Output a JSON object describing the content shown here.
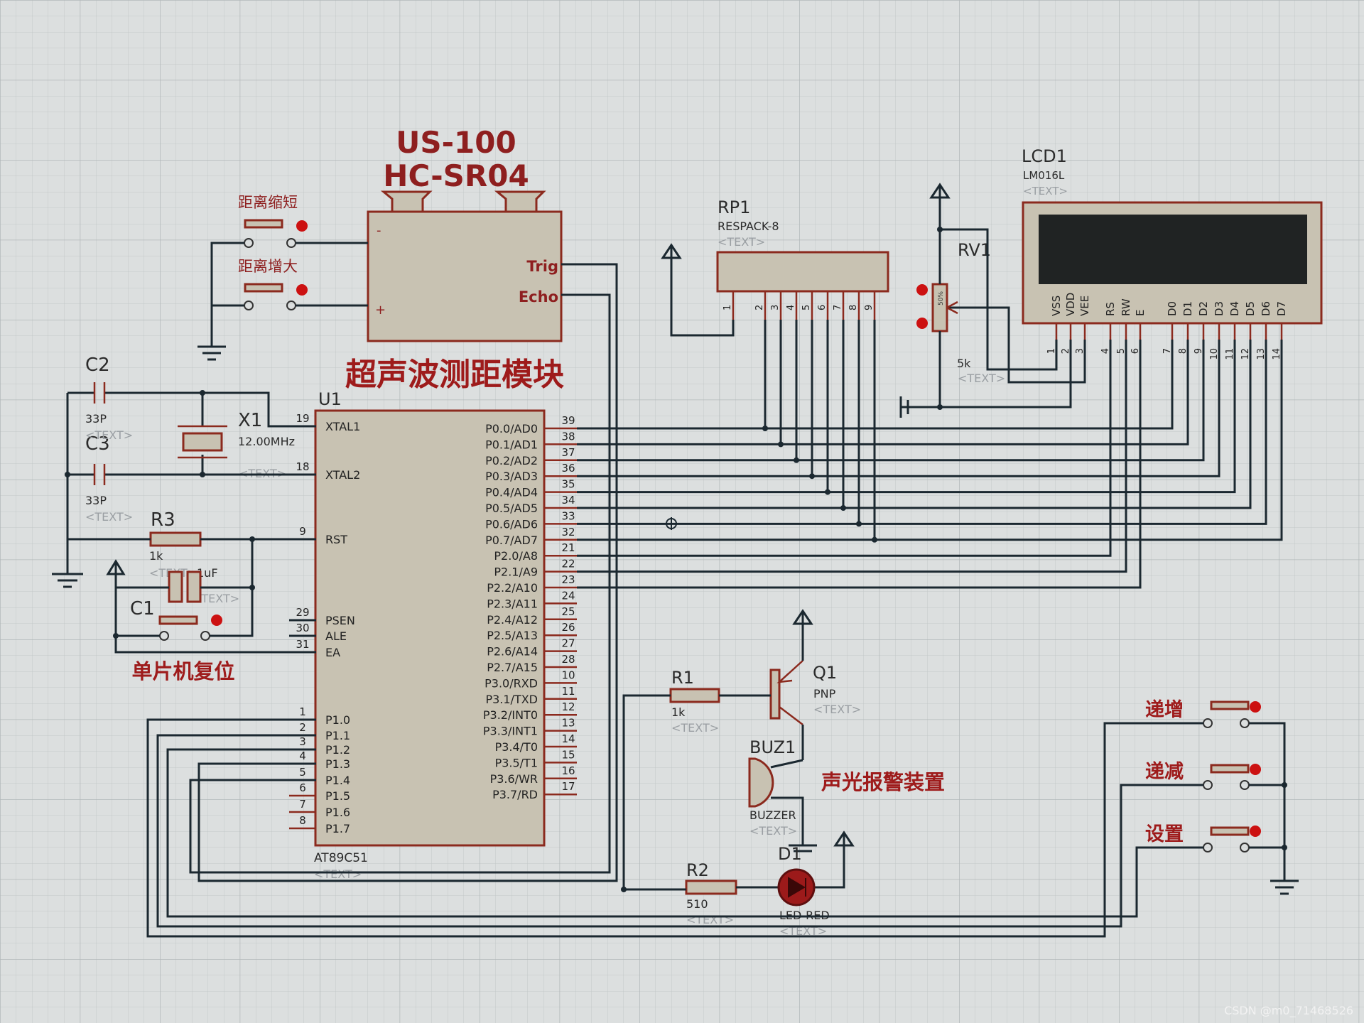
{
  "sensor": {
    "title1": "US-100",
    "title2": "HC-SR04",
    "pin_trig": "Trig",
    "pin_echo": "Echo",
    "pin_minus": "-",
    "pin_plus": "+",
    "caption": "超声波测距模块"
  },
  "buttons": {
    "dist_short": "距离缩短",
    "dist_long": "距离增大",
    "inc": "递增",
    "dec": "递减",
    "set": "设置"
  },
  "mcu": {
    "ref": "U1",
    "part": "AT89C51",
    "text": "<TEXT>",
    "left_pins": [
      {
        "num": "19",
        "name": "XTAL1"
      },
      {
        "num": "18",
        "name": "XTAL2"
      },
      {
        "num": "9",
        "name": "RST"
      },
      {
        "num": "29",
        "name": "PSEN"
      },
      {
        "num": "30",
        "name": "ALE"
      },
      {
        "num": "31",
        "name": "EA"
      },
      {
        "num": "1",
        "name": "P1.0"
      },
      {
        "num": "2",
        "name": "P1.1"
      },
      {
        "num": "3",
        "name": "P1.2"
      },
      {
        "num": "4",
        "name": "P1.3"
      },
      {
        "num": "5",
        "name": "P1.4"
      },
      {
        "num": "6",
        "name": "P1.5"
      },
      {
        "num": "7",
        "name": "P1.6"
      },
      {
        "num": "8",
        "name": "P1.7"
      }
    ],
    "right_pins": [
      {
        "num": "39",
        "name": "P0.0/AD0"
      },
      {
        "num": "38",
        "name": "P0.1/AD1"
      },
      {
        "num": "37",
        "name": "P0.2/AD2"
      },
      {
        "num": "36",
        "name": "P0.3/AD3"
      },
      {
        "num": "35",
        "name": "P0.4/AD4"
      },
      {
        "num": "34",
        "name": "P0.5/AD5"
      },
      {
        "num": "33",
        "name": "P0.6/AD6"
      },
      {
        "num": "32",
        "name": "P0.7/AD7"
      },
      {
        "num": "21",
        "name": "P2.0/A8"
      },
      {
        "num": "22",
        "name": "P2.1/A9"
      },
      {
        "num": "23",
        "name": "P2.2/A10"
      },
      {
        "num": "24",
        "name": "P2.3/A11"
      },
      {
        "num": "25",
        "name": "P2.4/A12"
      },
      {
        "num": "26",
        "name": "P2.5/A13"
      },
      {
        "num": "27",
        "name": "P2.6/A14"
      },
      {
        "num": "28",
        "name": "P2.7/A15"
      },
      {
        "num": "10",
        "name": "P3.0/RXD"
      },
      {
        "num": "11",
        "name": "P3.1/TXD"
      },
      {
        "num": "12",
        "name": "P3.2/INT0"
      },
      {
        "num": "13",
        "name": "P3.3/INT1"
      },
      {
        "num": "14",
        "name": "P3.4/T0"
      },
      {
        "num": "15",
        "name": "P3.5/T1"
      },
      {
        "num": "16",
        "name": "P3.6/WR"
      },
      {
        "num": "17",
        "name": "P3.7/RD"
      }
    ]
  },
  "crystal": {
    "c2": "C2",
    "c2_val": "33P",
    "c3": "C3",
    "c3_val": "33P",
    "x1": "X1",
    "x1_val": "12.00MHz",
    "text": "<TEXT>"
  },
  "reset": {
    "r3": "R3",
    "r3_val": "1k",
    "c1": "C1",
    "c1_val": "1uF",
    "caption": "单片机复位",
    "text": "<TEXT>"
  },
  "rp1": {
    "ref": "RP1",
    "part": "RESPACK-8",
    "text": "<TEXT>",
    "pins": [
      "1",
      "2",
      "3",
      "4",
      "5",
      "6",
      "7",
      "8",
      "9"
    ]
  },
  "rv1": {
    "ref": "RV1",
    "val": "5k",
    "pct": "50%",
    "text": "<TEXT>"
  },
  "lcd": {
    "ref": "LCD1",
    "part": "LM016L",
    "text": "<TEXT>",
    "pins": [
      {
        "name": "VSS",
        "num": "1"
      },
      {
        "name": "VDD",
        "num": "2"
      },
      {
        "name": "VEE",
        "num": "3"
      },
      {
        "name": "RS",
        "num": "4"
      },
      {
        "name": "RW",
        "num": "5"
      },
      {
        "name": "E",
        "num": "6"
      },
      {
        "name": "D0",
        "num": "7"
      },
      {
        "name": "D1",
        "num": "8"
      },
      {
        "name": "D2",
        "num": "9"
      },
      {
        "name": "D3",
        "num": "10"
      },
      {
        "name": "D4",
        "num": "11"
      },
      {
        "name": "D5",
        "num": "12"
      },
      {
        "name": "D6",
        "num": "13"
      },
      {
        "name": "D7",
        "num": "14"
      }
    ]
  },
  "alarm": {
    "r1": "R1",
    "r1_val": "1k",
    "q1": "Q1",
    "q1_type": "PNP",
    "buz": "BUZ1",
    "buz_type": "BUZZER",
    "r2": "R2",
    "r2_val": "510",
    "d1": "D1",
    "d1_type": "LED-RED",
    "caption": "声光报警装置",
    "text": "<TEXT>"
  },
  "watermark": "CSDN @m0_71468526"
}
